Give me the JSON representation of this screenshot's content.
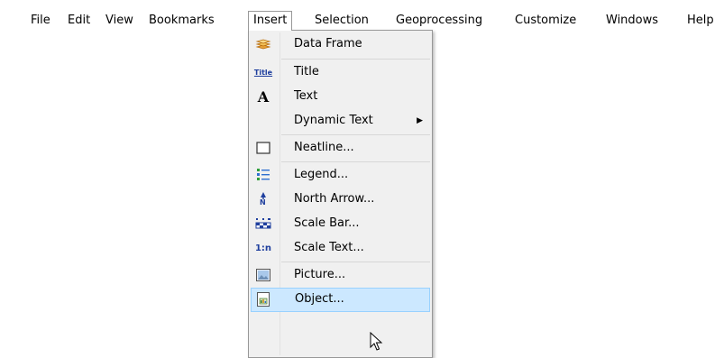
{
  "menubar": {
    "items": [
      "File",
      "Edit",
      "View",
      "Bookmarks",
      "Insert",
      "Selection",
      "Geoprocessing",
      "Customize",
      "Windows",
      "Help"
    ],
    "open_menu": "Insert"
  },
  "insert_menu": {
    "items": [
      {
        "label": "Data Frame",
        "icon": "data-frame-icon"
      },
      {
        "label": "Title",
        "icon": "title-icon",
        "icon_text": "Title"
      },
      {
        "label": "Text",
        "icon": "text-icon",
        "icon_text": "A"
      },
      {
        "label": "Dynamic Text",
        "icon": "",
        "submenu": true
      },
      {
        "label": "Neatline...",
        "icon": "neatline-icon"
      },
      {
        "label": "Legend...",
        "icon": "legend-icon"
      },
      {
        "label": "North Arrow...",
        "icon": "north-arrow-icon",
        "icon_text": "N"
      },
      {
        "label": "Scale Bar...",
        "icon": "scale-bar-icon"
      },
      {
        "label": "Scale Text...",
        "icon": "scale-text-icon",
        "icon_text": "1:n"
      },
      {
        "label": "Picture...",
        "icon": "picture-icon"
      },
      {
        "label": "Object...",
        "icon": "object-icon",
        "highlighted": true
      }
    ]
  },
  "colors": {
    "highlight_bg": "#cce8ff",
    "highlight_border": "#99d1ff",
    "menu_bg": "#f0f0f0"
  }
}
